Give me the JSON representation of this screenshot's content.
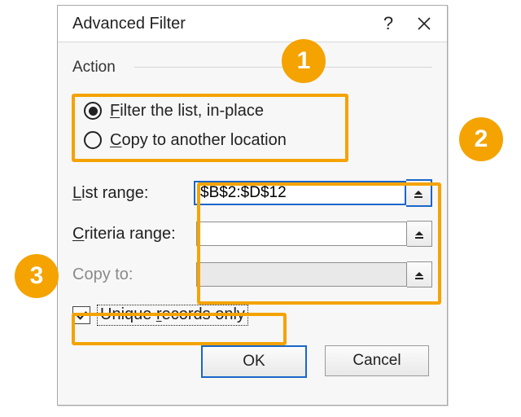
{
  "dialog": {
    "title": "Advanced Filter",
    "section_label": "Action",
    "radio1_pre": "F",
    "radio1_rest": "ilter the list, in-place",
    "radio2_pre": "C",
    "radio2_rest": "opy to another location",
    "list_range_pre": "L",
    "list_range_rest": "ist range:",
    "criteria_range_pre": "C",
    "criteria_range_rest": "riteria range:",
    "copy_to_label": "Copy to:",
    "list_range_value": "$B$2:$D$12",
    "criteria_range_value": "",
    "copy_to_value": "",
    "unique_pre": "Unique ",
    "unique_mid": "r",
    "unique_rest": "ecords only",
    "ok_label": "OK",
    "cancel_label": "Cancel"
  },
  "callouts": {
    "n1": "1",
    "n2": "2",
    "n3": "3"
  }
}
